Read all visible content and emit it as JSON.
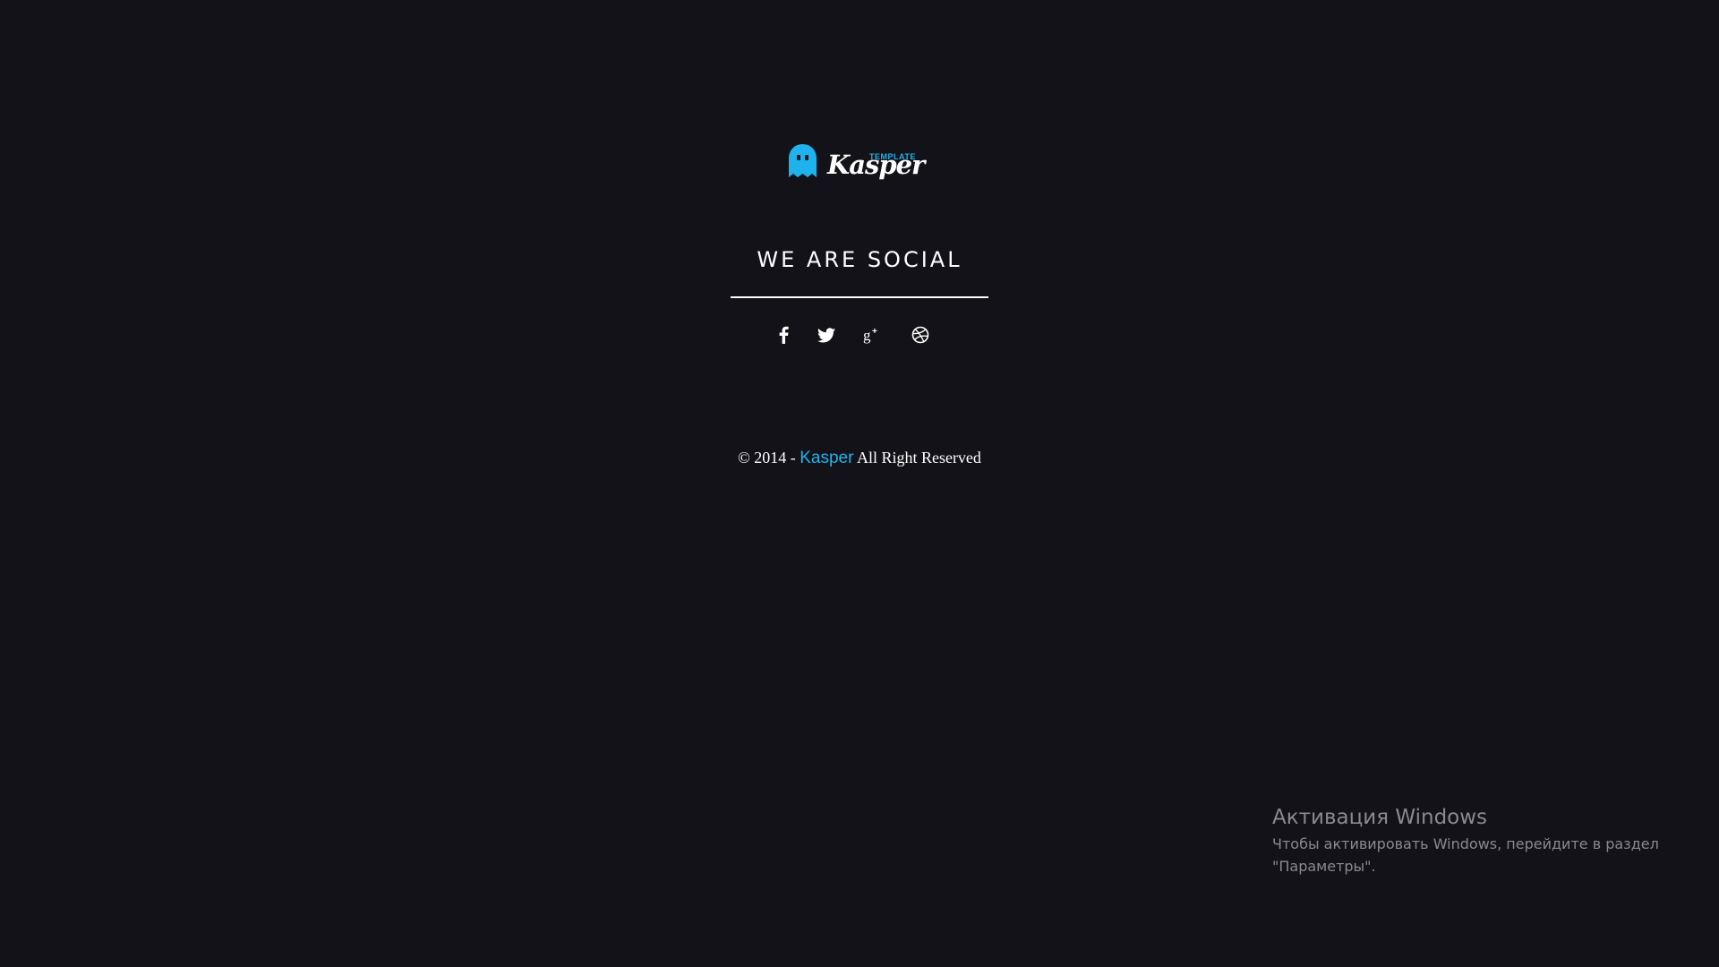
{
  "logo": {
    "word": "Kasper",
    "tag": "TEMPLATE",
    "accent_color": "#1fb3ee",
    "icon": "ghost-icon"
  },
  "social": {
    "title": "WE ARE SOCIAL",
    "icons": [
      {
        "name": "facebook-icon",
        "glyph": "f"
      },
      {
        "name": "twitter-icon",
        "glyph": "bird"
      },
      {
        "name": "google-plus-icon",
        "glyph": "g+"
      },
      {
        "name": "dribbble-icon",
        "glyph": "ball"
      }
    ]
  },
  "copyright": {
    "prefix": "© 2014 - ",
    "brand": "Kasper",
    "suffix": " All Right Reserved"
  },
  "windows_activation": {
    "title": "Активация Windows",
    "line1": "Чтобы активировать Windows, перейдите в раздел",
    "line2": "\"Параметры\"."
  },
  "colors": {
    "background": "#121218",
    "accent": "#1fb3ee",
    "text": "#ffffff",
    "watermark": "#8a8a8e"
  }
}
